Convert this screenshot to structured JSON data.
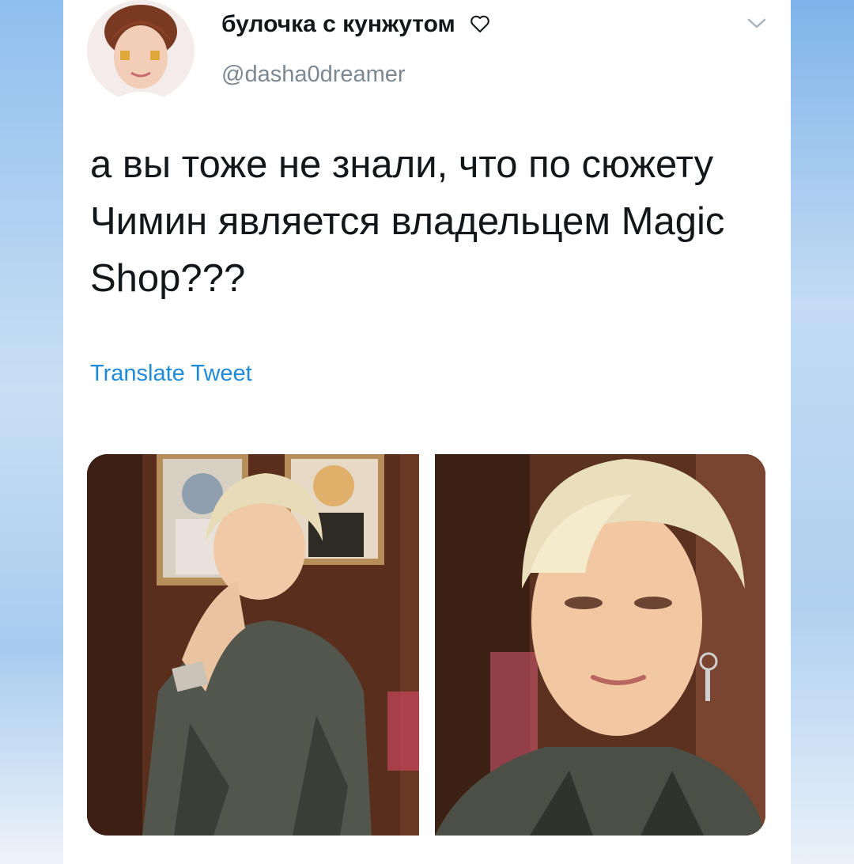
{
  "tweet": {
    "display_name": "булочка с кунжутом",
    "handle": "@dasha0dreamer",
    "text": "а вы тоже не знали, что по сюжету Чимин является владельцем Magic Shop???",
    "translate_label": "Translate Tweet"
  },
  "icons": {
    "name_suffix": "heart-outline-icon",
    "menu": "chevron-down-icon"
  },
  "colors": {
    "link": "#1f8ad9",
    "handle": "#7b8791",
    "text": "#14171a",
    "background": "#b3d2f1"
  }
}
